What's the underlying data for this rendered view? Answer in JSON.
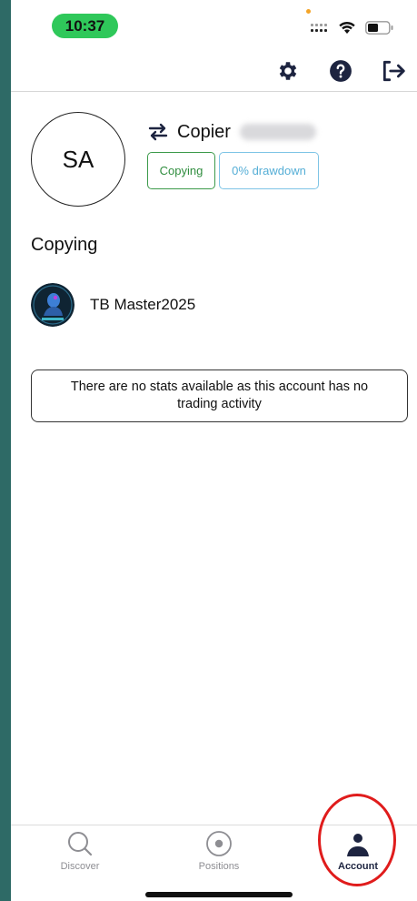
{
  "status_bar": {
    "time": "10:37"
  },
  "header": {
    "icons": [
      "gear-icon",
      "help-icon",
      "logout-icon"
    ]
  },
  "profile": {
    "initials": "SA",
    "account_name": "Copier",
    "badges": {
      "status": "Copying",
      "drawdown": "0% drawdown"
    }
  },
  "copying": {
    "title": "Copying",
    "masters": [
      {
        "name": "TB Master2025"
      }
    ]
  },
  "notice": "There are no stats available as this account has no trading activity",
  "tabs": [
    {
      "label": "Discover",
      "icon": "search-icon",
      "active": false
    },
    {
      "label": "Positions",
      "icon": "target-icon",
      "active": false
    },
    {
      "label": "Account",
      "icon": "person-icon",
      "active": true
    }
  ],
  "colors": {
    "background": "#2e6a66",
    "time_pill": "#2fc85a",
    "copying_badge": "#3c9a4a",
    "drawdown_badge": "#7ec4e6",
    "active_tab": "#1d2440",
    "highlight": "#e01c1c"
  }
}
